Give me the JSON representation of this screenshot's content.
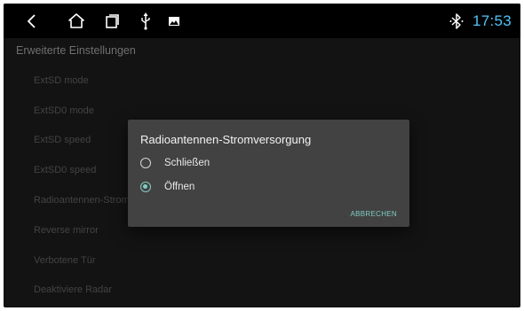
{
  "statusbar": {
    "nav_icons": [
      "back-icon",
      "home-icon",
      "recents-icon",
      "usb-icon",
      "image-icon"
    ],
    "bluetooth_icon": "bluetooth-icon",
    "time": "17:53",
    "time_color": "#4fc3f7"
  },
  "page": {
    "title": "Erweiterte Einstellungen",
    "items": [
      {
        "label": "ExtSD mode"
      },
      {
        "label": "ExtSD0 mode"
      },
      {
        "label": "ExtSD speed"
      },
      {
        "label": "ExtSD0 speed"
      },
      {
        "label": "Radioantennen-Stromversorgung"
      },
      {
        "label": "Reverse mirror"
      },
      {
        "label": "Verbotene Tür"
      },
      {
        "label": "Deaktiviere Radar"
      }
    ]
  },
  "dialog": {
    "title": "Radioantennen-Stromversorgung",
    "options": [
      {
        "label": "Schließen",
        "selected": false
      },
      {
        "label": "Öffnen",
        "selected": true
      }
    ],
    "cancel_label": "ABBRECHEN",
    "accent_color": "#80cbc4"
  }
}
